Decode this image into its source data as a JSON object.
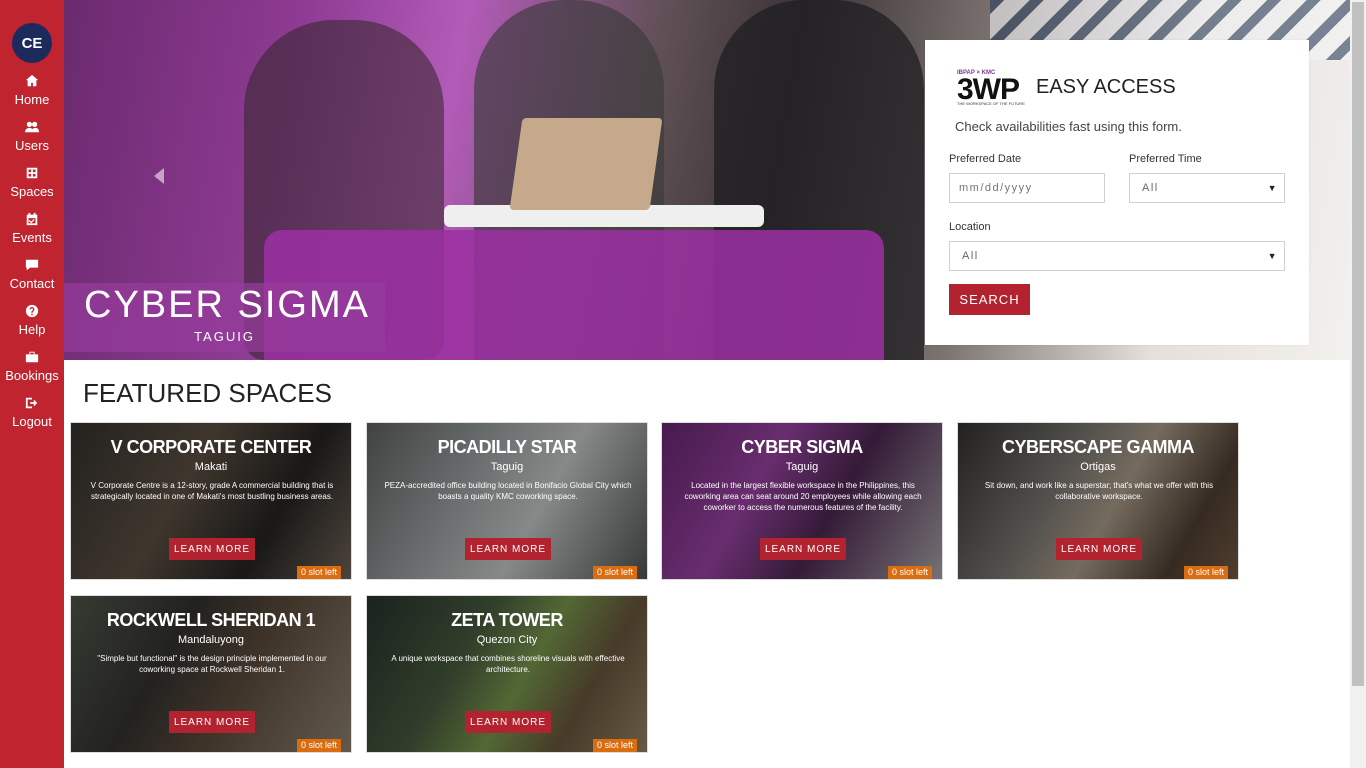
{
  "sidebar": {
    "avatar": "CE",
    "items": [
      {
        "label": "Home",
        "icon": "home-icon"
      },
      {
        "label": "Users",
        "icon": "users-icon"
      },
      {
        "label": "Spaces",
        "icon": "spaces-icon"
      },
      {
        "label": "Events",
        "icon": "calendar-icon"
      },
      {
        "label": "Contact",
        "icon": "chat-icon"
      },
      {
        "label": "Help",
        "icon": "help-icon"
      },
      {
        "label": "Bookings",
        "icon": "briefcase-icon"
      },
      {
        "label": "Logout",
        "icon": "logout-icon"
      }
    ]
  },
  "hero": {
    "title": "CYBER SIGMA",
    "location": "TAGUIG"
  },
  "easy_access": {
    "logo_top": "IBPAP × KMC",
    "logo_main": "3WP",
    "logo_tag": "THE WORKSPACE OF THE FUTURE",
    "title": "EASY ACCESS",
    "subtitle": "Check availabilities fast using this form.",
    "date_label": "Preferred Date",
    "date_placeholder": "mm/dd/yyyy",
    "time_label": "Preferred Time",
    "time_value": "All",
    "location_label": "Location",
    "location_value": "All",
    "search_label": "SEARCH"
  },
  "featured": {
    "title": "FEATURED SPACES",
    "learn_more": "LEARN MORE",
    "cards": [
      {
        "title": "V CORPORATE CENTER",
        "location": "Makati",
        "description": "V Corporate Centre is a 12-story, grade A commercial building that is strategically located in one of Makati's most bustling business areas.",
        "slots": "0 slot left"
      },
      {
        "title": "PICADILLY STAR",
        "location": "Taguig",
        "description": "PEZA-accredited office building located in Bonifacio Global City which boasts a quality KMC coworking space.",
        "slots": "0 slot left"
      },
      {
        "title": "CYBER SIGMA",
        "location": "Taguig",
        "description": "Located in the largest flexible workspace in the Philippines, this coworking area can seat around 20 employees while allowing each coworker to access the numerous features of the facility.",
        "slots": "0 slot left"
      },
      {
        "title": "CYBERSCAPE GAMMA",
        "location": "Ortigas",
        "description": "Sit down, and work like a superstar; that's what we offer with this collaborative workspace.",
        "slots": "0 slot left"
      },
      {
        "title": "ROCKWELL SHERIDAN 1",
        "location": "Mandaluyong",
        "description": "\"Simple but functional\" is the design principle implemented in our coworking space at Rockwell Sheridan 1.",
        "slots": "0 slot left"
      },
      {
        "title": "ZETA TOWER",
        "location": "Quezon City",
        "description": "A unique workspace that combines shoreline visuals with effective architecture.",
        "slots": "0 slot left"
      }
    ]
  },
  "colors": {
    "sidebar": "#c0242f",
    "accent": "#b2232f",
    "avatar": "#1c2a5c",
    "slot_badge": "#d96d0f"
  }
}
